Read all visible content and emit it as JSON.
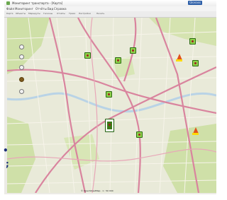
{
  "window": {
    "title": "Мониторинг транспорта - [Карта]",
    "logo_text": "Glonass"
  },
  "menubar": {
    "items": [
      "Файл",
      "Мониторинг",
      "Отчёты",
      "Вид",
      "Справка"
    ]
  },
  "toolbar": {
    "items": [
      "Карта",
      "Объекты",
      "Маршруты",
      "Геозоны",
      "Отчёты",
      "Треки",
      "Настройки",
      "Печать"
    ]
  },
  "map": {
    "colors": {
      "major_road": "#d9849e",
      "minor_road": "#f5f2e8",
      "green": "#cfe0a8",
      "river": "#b9d3e6"
    },
    "scale_text": "© OpenStreetMap · 1 : 50 000",
    "markers": [
      {
        "name": "vehicle-1",
        "icon": "truck-icon",
        "state": "moving"
      },
      {
        "name": "vehicle-2",
        "icon": "truck-icon",
        "state": "parked"
      },
      {
        "name": "vehicle-3",
        "icon": "truck-icon",
        "state": "moving"
      },
      {
        "name": "vehicle-4",
        "icon": "truck-icon",
        "state": "moving"
      },
      {
        "name": "vehicle-5",
        "icon": "truck-icon",
        "state": "moving"
      },
      {
        "name": "vehicle-6",
        "icon": "truck-icon",
        "state": "selected"
      },
      {
        "name": "vehicle-7",
        "icon": "truck-icon",
        "state": "moving"
      },
      {
        "name": "vehicle-8",
        "icon": "truck-icon",
        "state": "moving"
      },
      {
        "name": "warning-1",
        "icon": "traffic-cone-icon",
        "state": "alert"
      },
      {
        "name": "warning-2",
        "icon": "traffic-cone-icon",
        "state": "alert"
      }
    ]
  },
  "slide": {
    "bullet_1": "•",
    "bullet_2": ";"
  }
}
